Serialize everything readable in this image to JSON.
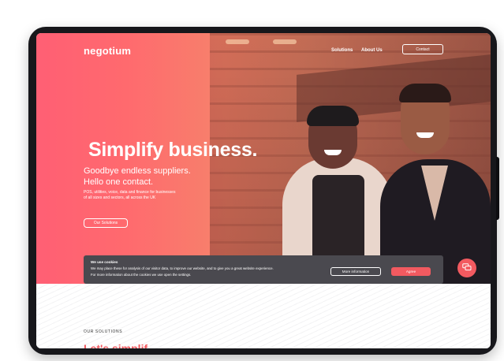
{
  "nav": {
    "logo": "negotium",
    "links": [
      "Solutions",
      "About Us"
    ],
    "contact_label": "Contact"
  },
  "hero": {
    "headline": "Simplify business.",
    "subheadline_line1": "Goodbye endless suppliers.",
    "subheadline_line2": "Hello one contact.",
    "description_line1": "POS, utilities, voice, data and finance for businesses",
    "description_line2": "of all sizes and sectors, all across the UK",
    "cta_label": "Our Solutions"
  },
  "cookie_banner": {
    "title": "We use cookies",
    "line1": "We may place these for analysis of our visitor data, to improve our website, and to give you a great website experience.",
    "line2": "For more information about the cookies we use open the settings.",
    "more_info_label": "More information",
    "agree_label": "Agree"
  },
  "solutions_section": {
    "label": "OUR SOLUTIONS",
    "heading": "Let's simplif"
  },
  "colors": {
    "accent": "#f25a60",
    "hero_pink": "#ff5f74",
    "banner": "#4a494f"
  },
  "icons": {
    "chat": "chat-bubble-icon"
  }
}
